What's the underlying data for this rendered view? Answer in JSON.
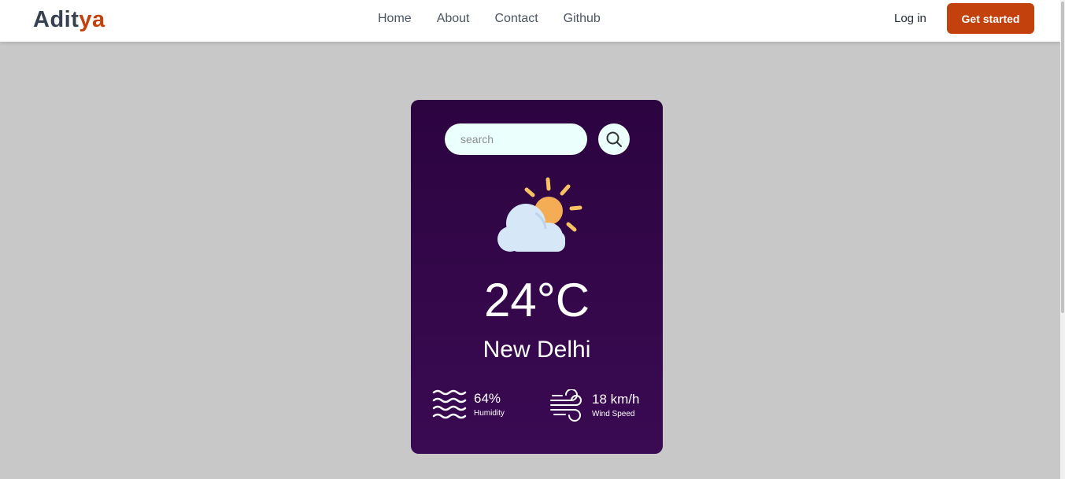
{
  "brand": {
    "prefix": "Adit",
    "accent": "ya"
  },
  "nav": {
    "links": [
      "Home",
      "About",
      "Contact",
      "Github"
    ],
    "login": "Log in",
    "cta": "Get started"
  },
  "colors": {
    "accent": "#c2410c",
    "card": "#2c0440",
    "input_bg": "#ebfffc",
    "page_bg": "#c8c8c8"
  },
  "weather": {
    "search_placeholder": "search",
    "icon": "partly-cloudy-icon",
    "temperature": "24°C",
    "city": "New Delhi",
    "humidity": {
      "value": "64%",
      "label": "Humidity",
      "icon": "humidity-waves-icon"
    },
    "wind": {
      "value": "18 km/h",
      "label": "Wind Speed",
      "icon": "wind-icon"
    }
  }
}
